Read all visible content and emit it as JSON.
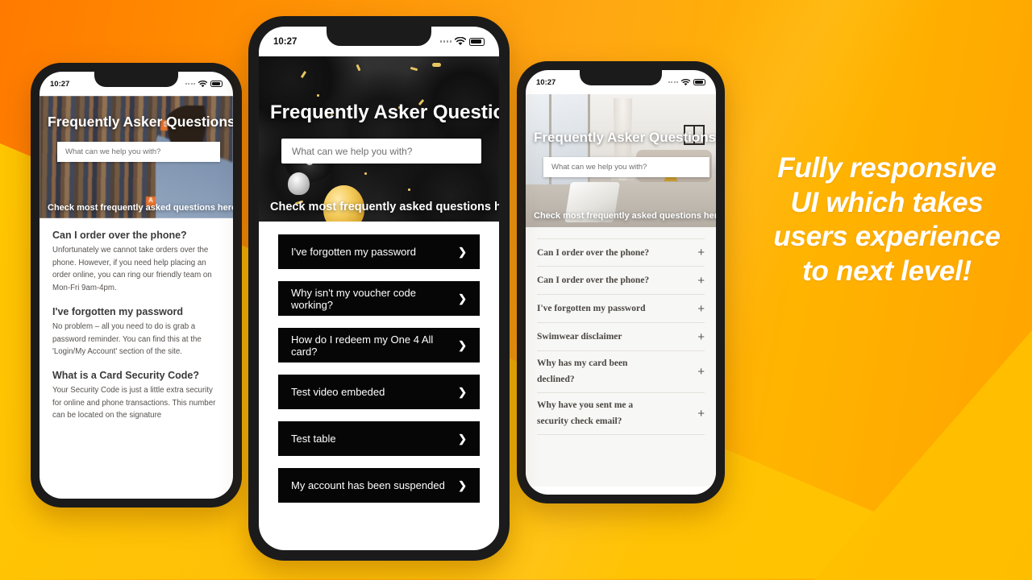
{
  "background": {
    "orange": "#FF8B00",
    "yellow": "#FFC107",
    "accent": "#FFA300"
  },
  "promo": {
    "text": "Fully responsive UI which takes users experience to next level!",
    "color": "#FFFFFF"
  },
  "status_bar": {
    "time": "10:27",
    "signal_icon": "signal-dots-icon",
    "wifi_icon": "wifi-icon",
    "battery_icon": "battery-icon"
  },
  "hero": {
    "title": "Frequently Asker Questions",
    "search_placeholder": "What can we help you with?",
    "search_value": "",
    "subtitle": "Check most frequently asked questions here"
  },
  "phones": [
    {
      "id": "phone-left",
      "variant": "article-list",
      "photo": "library-bookshelf-photo",
      "faq_entries": [
        {
          "question": "Can I order over the phone?",
          "answer": "Unfortunately we cannot take orders over the phone. However, if you need help placing an order online, you can ring our friendly team on Mon-Fri 9am-4pm."
        },
        {
          "question": "I've forgotten my password",
          "answer": "No problem – all you need to do is grab a password reminder. You can find this at the 'Login/My Account' section of the site."
        },
        {
          "question": "What is a Card Security Code?",
          "answer": "Your Security Code is just a little extra security for online and phone transactions. This number can be located on the signature"
        }
      ]
    },
    {
      "id": "phone-center",
      "variant": "dark-button-list",
      "photo": "black-balloons-confetti-photo",
      "items": [
        {
          "label": "I've forgotten my password",
          "icon": "chevron-right-icon"
        },
        {
          "label": "Why isn't my voucher code working?",
          "icon": "chevron-right-icon"
        },
        {
          "label": "How do I redeem my One 4 All card?",
          "icon": "chevron-right-icon"
        },
        {
          "label": "Test video embeded",
          "icon": "chevron-right-icon"
        },
        {
          "label": "Test table",
          "icon": "chevron-right-icon"
        },
        {
          "label": "My account has been suspended",
          "icon": "chevron-right-icon"
        }
      ]
    },
    {
      "id": "phone-right",
      "variant": "serif-accordion",
      "photo": "interior-room-photo",
      "items": [
        {
          "label": "Can I order over the phone?",
          "icon": "plus-icon"
        },
        {
          "label": "Can I order over the phone?",
          "icon": "plus-icon"
        },
        {
          "label": "I've forgotten my password",
          "icon": "plus-icon"
        },
        {
          "label": "Swimwear disclaimer",
          "icon": "plus-icon"
        },
        {
          "label": "Why has my card been declined?",
          "icon": "plus-icon"
        },
        {
          "label": "Why have you sent me a security check email?",
          "icon": "plus-icon"
        }
      ]
    }
  ]
}
